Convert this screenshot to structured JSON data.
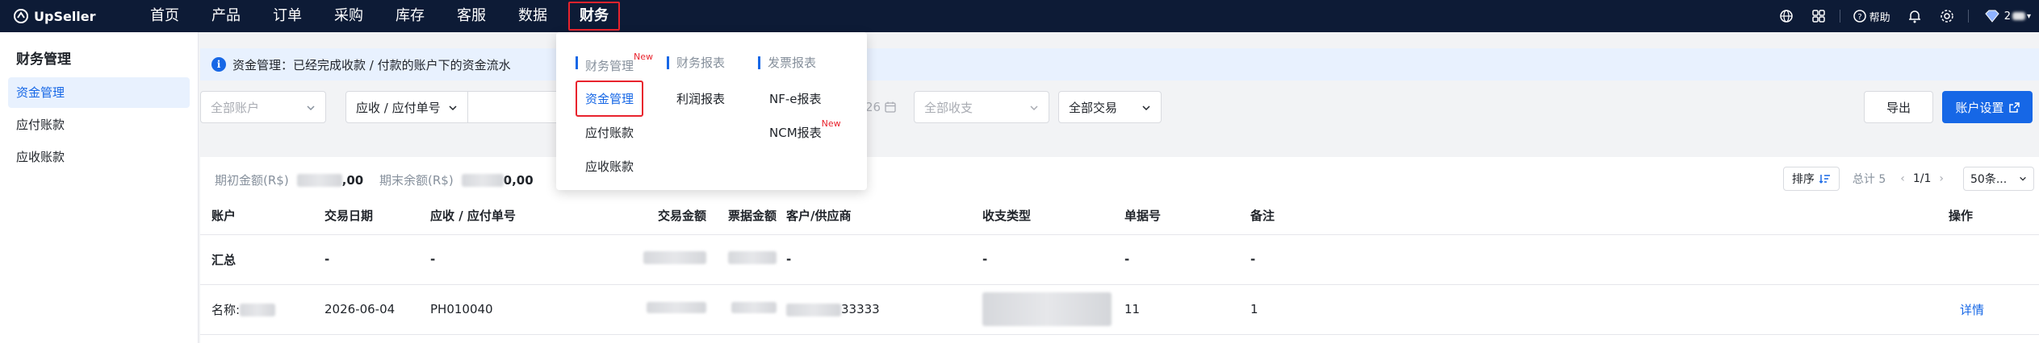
{
  "app": {
    "logo_text": "UpSeller"
  },
  "nav": {
    "items": [
      {
        "label": "首页"
      },
      {
        "label": "产品"
      },
      {
        "label": "订单"
      },
      {
        "label": "采购"
      },
      {
        "label": "库存"
      },
      {
        "label": "客服"
      },
      {
        "label": "数据"
      },
      {
        "label": "财务",
        "active": true
      }
    ],
    "help_label": "帮助",
    "user_name": "2"
  },
  "sidebar": {
    "title": "财务管理",
    "items": [
      {
        "label": "资金管理",
        "active": true
      },
      {
        "label": "应付账款"
      },
      {
        "label": "应收账款"
      }
    ]
  },
  "notice": {
    "text": "资金管理：已经完成收款 / 付款的账户下的资金流水"
  },
  "filters": {
    "account": "全部账户",
    "doc_type": "应收 / 应付单号",
    "date_tail": "26",
    "income_type": "全部收支",
    "transaction": "全部交易",
    "export_label": "导出",
    "settings_label": "账户设置"
  },
  "summary": {
    "opening_label": "期初金额(R$)",
    "opening_value": ",00",
    "closing_label": "期末余额(R$)",
    "closing_value": "0,00"
  },
  "pager": {
    "sort_label": "排序",
    "total_label": "总计 5",
    "page": "1/1",
    "page_size": "50条..."
  },
  "table": {
    "headers": [
      "账户",
      "交易日期",
      "应收 / 应付单号",
      "交易金额",
      "票据金额",
      "客户/供应商",
      "收支类型",
      "单据号",
      "备注",
      "操作"
    ],
    "total_row": {
      "account": "汇总",
      "date": "-",
      "doc": "-",
      "customer": "-",
      "type": "-",
      "bill": "-",
      "note": "-"
    },
    "rows": [
      {
        "account": "名称:",
        "date": "2026-06-04",
        "doc": "PH010040",
        "customer": "33333",
        "bill": "11",
        "note": "1",
        "action": "详情"
      }
    ]
  },
  "finance_menu": {
    "columns": [
      {
        "title": "财务管理",
        "badge": "New",
        "items": [
          {
            "label": "资金管理",
            "active": true
          },
          {
            "label": "应付账款"
          },
          {
            "label": "应收账款"
          }
        ]
      },
      {
        "title": "财务报表",
        "items": [
          {
            "label": "利润报表"
          }
        ]
      },
      {
        "title": "发票报表",
        "items": [
          {
            "label": "NF-e报表"
          },
          {
            "label": "NCM报表",
            "badge": "New"
          }
        ]
      }
    ]
  },
  "colors": {
    "nav_bg": "#0d1b36",
    "accent": "#1667e6",
    "highlight": "#e8232d"
  }
}
